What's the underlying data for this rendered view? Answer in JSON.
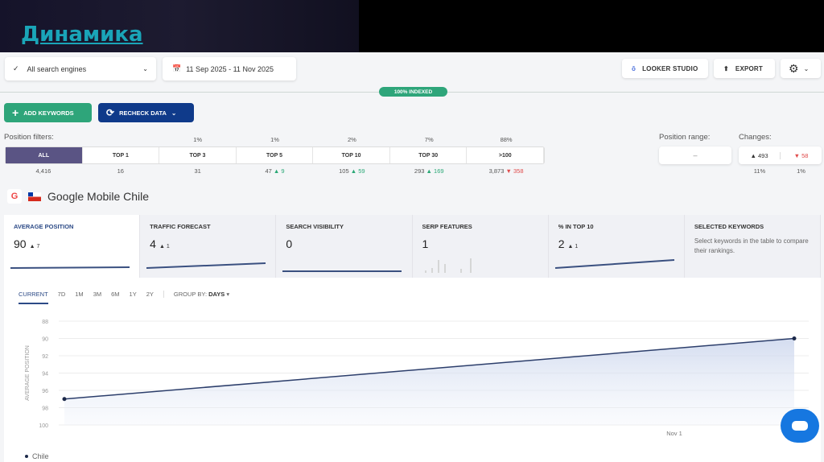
{
  "banner": {
    "title": "Динамика"
  },
  "toolbar": {
    "engine": "All search engines",
    "date_range": "11 Sep 2025 - 11 Nov 2025",
    "looker": "LOOKER STUDIO",
    "export": "EXPORT",
    "indexed": "100% INDEXED",
    "add_keywords": "ADD KEYWORDS",
    "recheck": "RECHECK DATA"
  },
  "filters": {
    "label": "Position filters:",
    "tabs": [
      {
        "label": "ALL",
        "pct": "",
        "count": "4,416",
        "delta": "",
        "dir": ""
      },
      {
        "label": "TOP 1",
        "pct": "",
        "count": "16",
        "delta": "",
        "dir": ""
      },
      {
        "label": "TOP 3",
        "pct": "1%",
        "count": "31",
        "delta": "",
        "dir": ""
      },
      {
        "label": "TOP 5",
        "pct": "1%",
        "count": "47",
        "delta": "▲ 9",
        "dir": "up"
      },
      {
        "label": "TOP 10",
        "pct": "2%",
        "count": "105",
        "delta": "▲ 59",
        "dir": "up"
      },
      {
        "label": "TOP 30",
        "pct": "7%",
        "count": "293",
        "delta": "▲ 169",
        "dir": "up"
      },
      {
        "label": ">100",
        "pct": "88%",
        "count": "3,873",
        "delta": "▼ 358",
        "dir": "down"
      }
    ]
  },
  "range": {
    "label": "Position range:",
    "value": "–"
  },
  "changes": {
    "label": "Changes:",
    "up": "▲ 493",
    "down": "▼ 58",
    "up_pct": "11%",
    "down_pct": "1%"
  },
  "engine_title": "Google Mobile Chile",
  "cards": [
    {
      "title": "AVERAGE POSITION",
      "value": "90",
      "delta": "▲ 7"
    },
    {
      "title": "TRAFFIC FORECAST",
      "value": "4",
      "delta": "▲ 1"
    },
    {
      "title": "SEARCH VISIBILITY",
      "value": "0",
      "delta": ""
    },
    {
      "title": "SERP FEATURES",
      "value": "1",
      "delta": ""
    },
    {
      "title": "% IN TOP 10",
      "value": "2",
      "delta": "▲ 1"
    },
    {
      "title": "SELECTED KEYWORDS",
      "desc": "Select keywords in the table to compare their rankings."
    }
  ],
  "periods": [
    "CURRENT",
    "7D",
    "1M",
    "3M",
    "6M",
    "1Y",
    "2Y"
  ],
  "group_by": {
    "label": "GROUP BY:",
    "value": "DAYS"
  },
  "colors": {
    "accent": "#2c4a86",
    "green": "#2ea57a",
    "navy": "#0f3a8a",
    "purple": "#5a5484"
  },
  "chart_data": {
    "type": "line",
    "ylabel": "AVERAGE POSITION",
    "yticks": [
      88,
      90,
      92,
      94,
      96,
      98,
      100
    ],
    "ylim": [
      88,
      100
    ],
    "inverted": true,
    "xtick_labels": [
      "Nov 1"
    ],
    "series": [
      {
        "name": "Chile",
        "x": [
          "11 Sep 2025",
          "11 Nov 2025"
        ],
        "values": [
          97,
          90
        ]
      }
    ],
    "legend": "bottom-left",
    "grid": true
  }
}
